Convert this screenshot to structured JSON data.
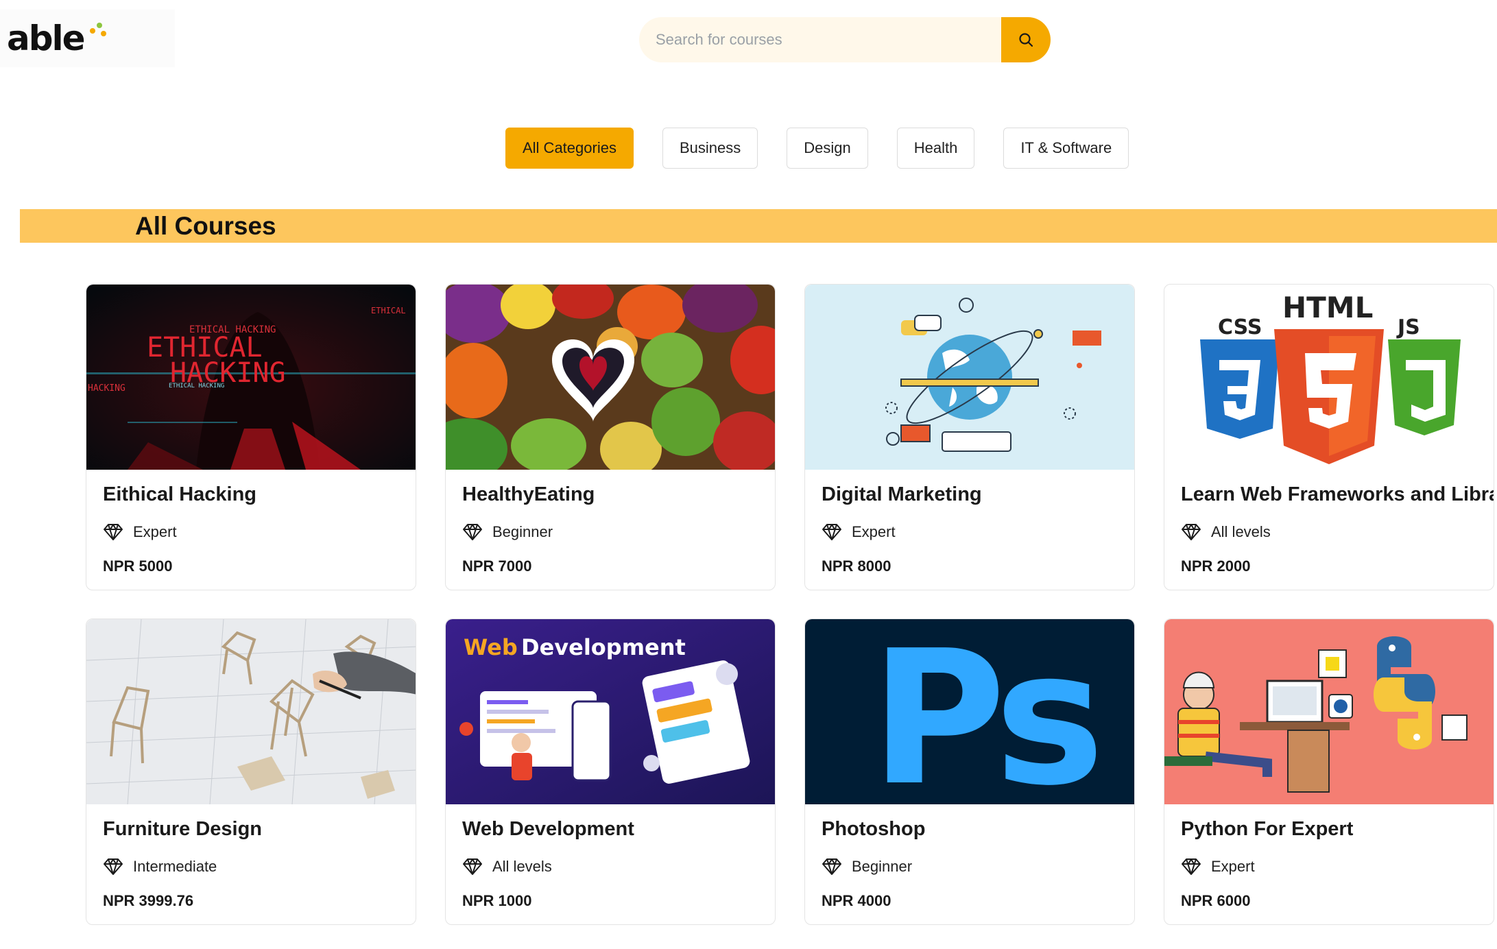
{
  "brand": {
    "logo_text": "able",
    "dot_colors": [
      "#f5a900",
      "#8dc63f",
      "#f5a900"
    ]
  },
  "search": {
    "placeholder": "Search for courses",
    "button_icon": "search-icon"
  },
  "categories": [
    {
      "label": "All Categories",
      "active": true
    },
    {
      "label": "Business",
      "active": false
    },
    {
      "label": "Design",
      "active": false
    },
    {
      "label": "Health",
      "active": false
    },
    {
      "label": "IT & Software",
      "active": false
    }
  ],
  "section": {
    "title": "All Courses"
  },
  "level_icon": "diamond-icon",
  "courses": [
    {
      "title": "Eithical Hacking",
      "level": "Expert",
      "price": "NPR 5000",
      "image": "ethical-hacking-image",
      "image_text": {
        "t1": "ETHICAL HACKING",
        "t2": "ETHICAL",
        "t3": "HACKING",
        "t4": "ETHICAL",
        "t5": "HACKING",
        "t6": "ETHICAL HACKING"
      }
    },
    {
      "title": "HealthyEating",
      "level": "Beginner",
      "price": "NPR 7000",
      "image": "healthy-food-image"
    },
    {
      "title": "Digital Marketing",
      "level": "Expert",
      "price": "NPR 8000",
      "image": "digital-marketing-image"
    },
    {
      "title": "Learn Web Frameworks and Library",
      "level": "All levels",
      "price": "NPR 2000",
      "image": "html-css-js-image",
      "image_text": {
        "html": "HTML",
        "css": "CSS",
        "js": "JS"
      }
    },
    {
      "title": "Furniture Design",
      "level": "Intermediate",
      "price": "NPR 3999.76",
      "image": "furniture-design-image"
    },
    {
      "title": "Web Development",
      "level": "All levels",
      "price": "NPR 1000",
      "image": "web-development-image",
      "image_text": {
        "w1": "Web",
        "w2": "Development"
      }
    },
    {
      "title": "Photoshop",
      "level": "Beginner",
      "price": "NPR 4000",
      "image": "photoshop-image",
      "image_text": {
        "ps": "Ps"
      }
    },
    {
      "title": "Python For Expert",
      "level": "Expert",
      "price": "NPR 6000",
      "image": "python-image"
    }
  ],
  "colors": {
    "accent": "#f5a900",
    "banner": "#fdc65d",
    "search_bg": "#fff8ea"
  }
}
